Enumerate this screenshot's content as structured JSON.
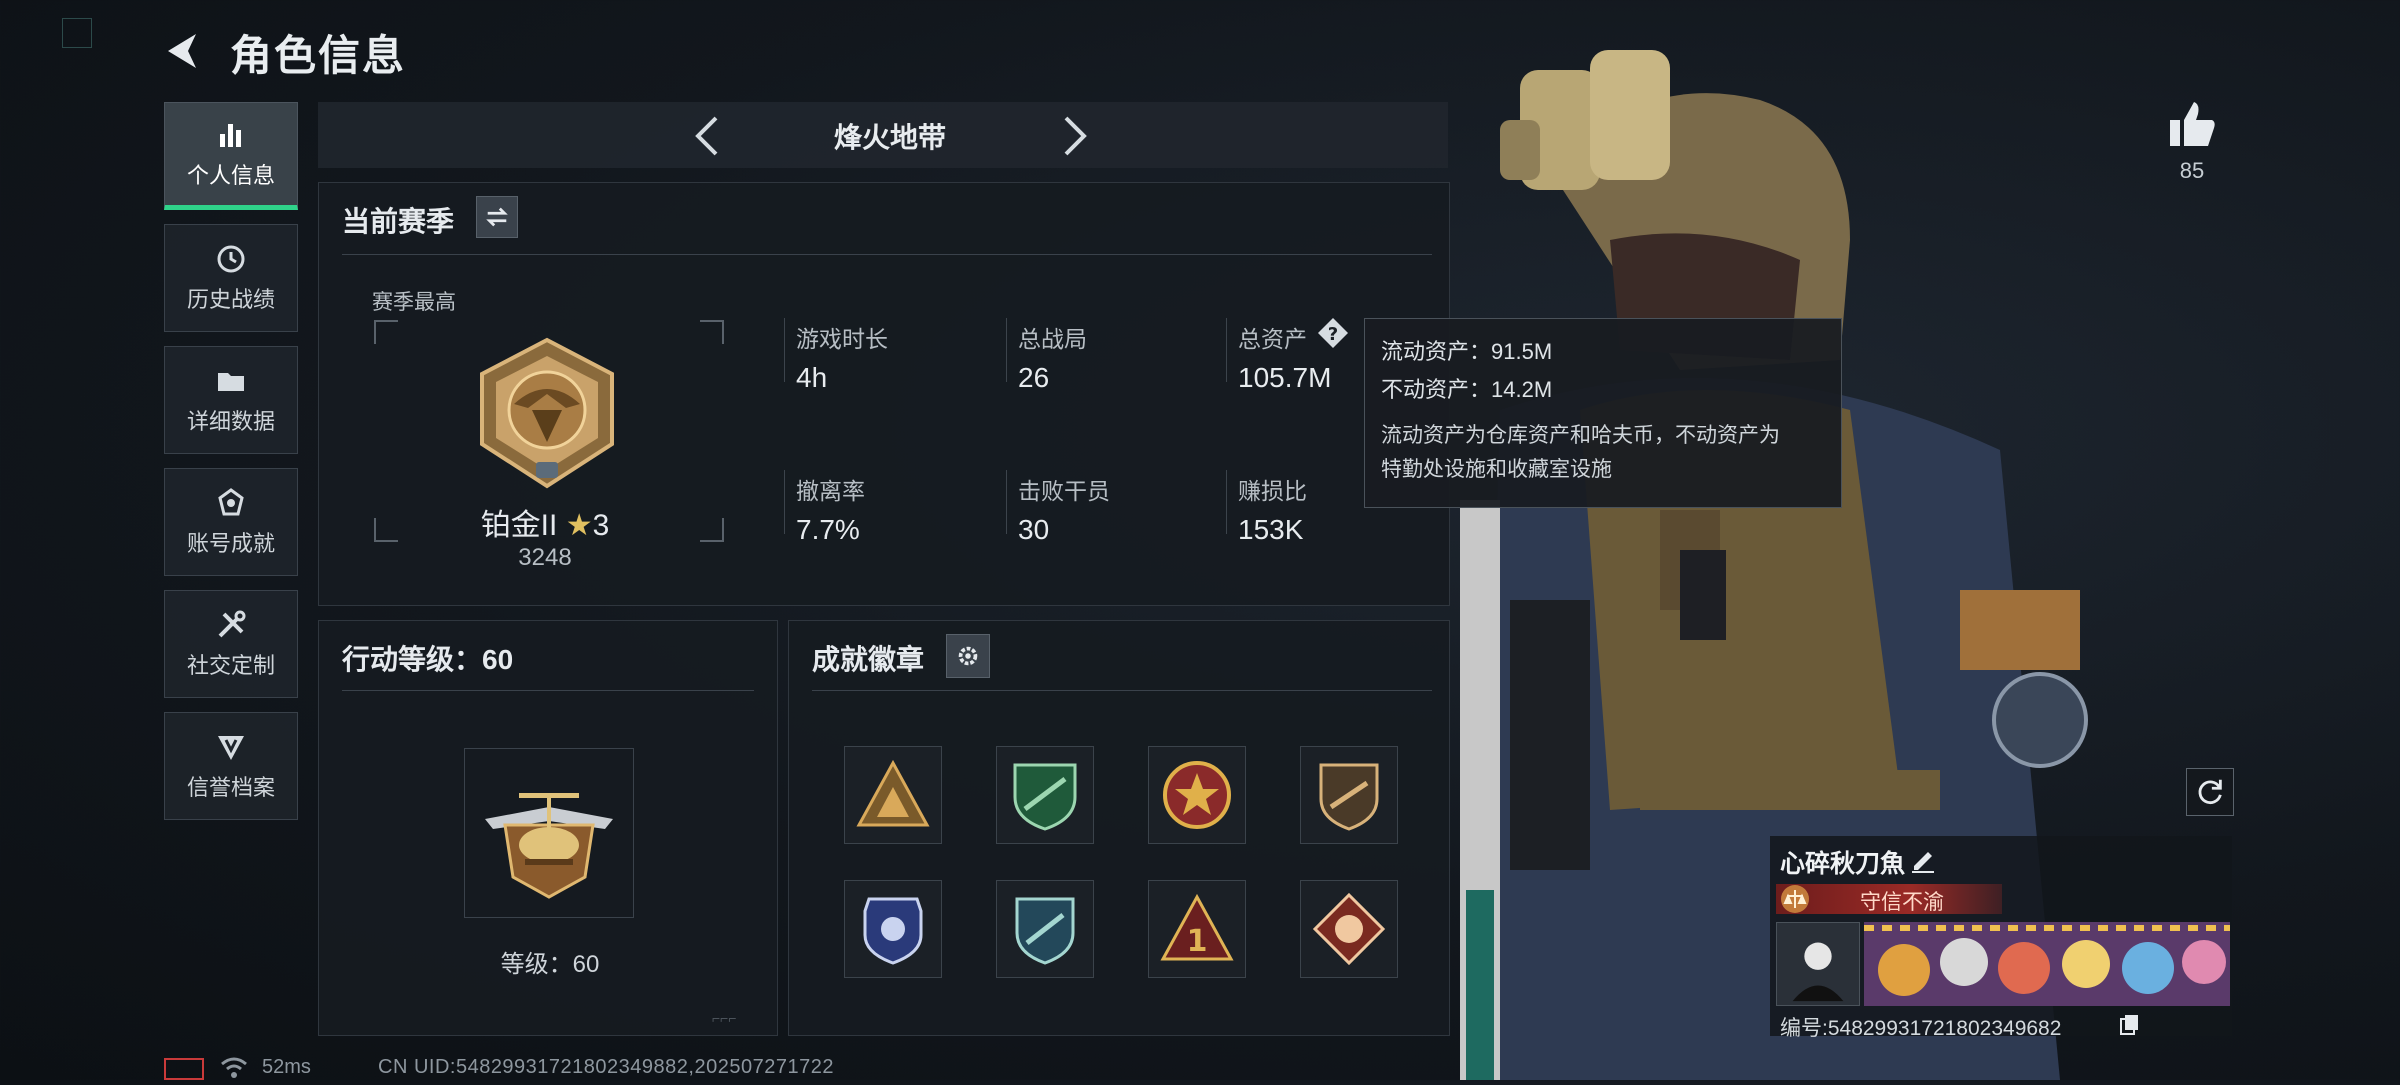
{
  "header": {
    "title": "角色信息",
    "back_icon": "back-arrow-icon"
  },
  "nav": {
    "items": [
      {
        "label": "个人信息",
        "icon": "bar-chart-icon",
        "active": true
      },
      {
        "label": "历史战绩",
        "icon": "clock-icon",
        "active": false
      },
      {
        "label": "详细数据",
        "icon": "folder-icon",
        "active": false
      },
      {
        "label": "账号成就",
        "icon": "achievement-icon",
        "active": false
      },
      {
        "label": "社交定制",
        "icon": "tools-icon",
        "active": false
      },
      {
        "label": "信誉档案",
        "icon": "shield-badge-icon",
        "active": false
      }
    ]
  },
  "mode": {
    "title": "烽火地带"
  },
  "season": {
    "title": "当前赛季",
    "best_label": "赛季最高",
    "rank_name": "铂金II",
    "rank_stars": "3",
    "rank_score": "3248",
    "stats": [
      {
        "label": "游戏时长",
        "value": "4h"
      },
      {
        "label": "总战局",
        "value": "26"
      },
      {
        "label": "总资产",
        "value": "105.7M"
      },
      {
        "label": "撤离率",
        "value": "7.7%"
      },
      {
        "label": "击败干员",
        "value": "30"
      },
      {
        "label": "赚损比",
        "value": "153K"
      }
    ]
  },
  "tooltip": {
    "liquid": "流动资产：91.5M",
    "fixed": "不动资产：14.2M",
    "desc_line1": "流动资产为仓库资产和哈夫币，不动资产为",
    "desc_line2": "特勤处设施和收藏室设施"
  },
  "level": {
    "title": "行动等级：60",
    "level_text": "等级：60"
  },
  "badges": {
    "title": "成就徽章",
    "items": [
      {
        "name": "triangle-squad-badge",
        "colors": [
          "#7a5a2a",
          "#d9a95a"
        ]
      },
      {
        "name": "green-rifle-shield-badge",
        "colors": [
          "#1f5a3a",
          "#9cd6b0"
        ]
      },
      {
        "name": "red-star-medal-badge",
        "colors": [
          "#8a2a2a",
          "#e0b04a"
        ]
      },
      {
        "name": "bronze-sniper-shield-badge",
        "colors": [
          "#4a3a28",
          "#d8b27a"
        ]
      },
      {
        "name": "blue-police-badge",
        "colors": [
          "#2a3a7a",
          "#c9d3ef"
        ]
      },
      {
        "name": "blue-green-shield-badge",
        "colors": [
          "#23485a",
          "#a4d6d0"
        ]
      },
      {
        "name": "number-one-triangle-badge",
        "colors": [
          "#6a1f1f",
          "#e0b455"
        ]
      },
      {
        "name": "red-diamond-beast-badge",
        "colors": [
          "#7a2a20",
          "#f0c8a0"
        ]
      }
    ]
  },
  "like": {
    "count": "85"
  },
  "profile": {
    "name": "心碎秋刀魚",
    "honor": "守信不渝",
    "id_text": "编号:5482993172180234968​2"
  },
  "status": {
    "ping": "52ms",
    "uid_line": "CN UID:5482993172180234988​2,202507271722"
  },
  "colors": {
    "accent": "#2fd38a",
    "tooltip_bg": "#181c21",
    "honor_red": "#9a2a26"
  }
}
